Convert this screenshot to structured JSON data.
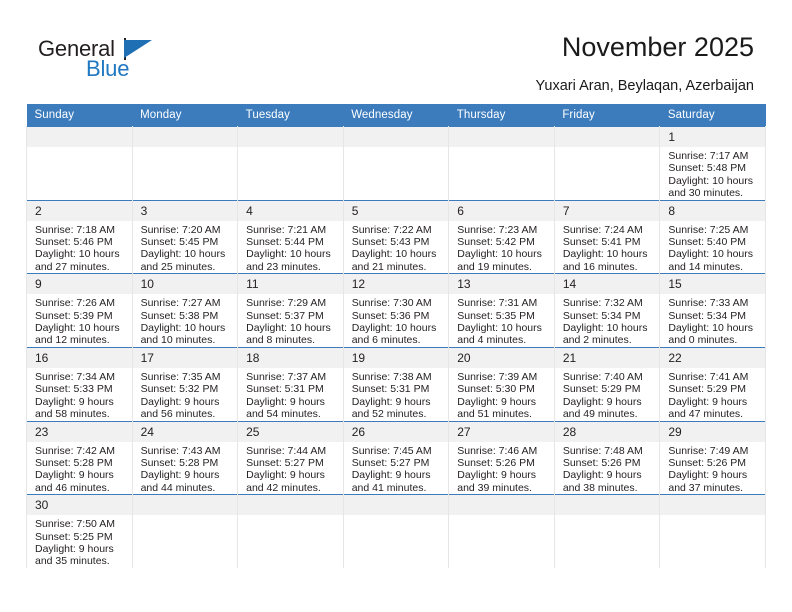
{
  "brand": {
    "name_part1": "General",
    "name_part2": "Blue",
    "accent_color": "#1f6fb5"
  },
  "header": {
    "title": "November 2025",
    "subtitle": "Yuxari Aran, Beylaqan, Azerbaijan",
    "header_bg": "#3c7cbd",
    "daynum_bg": "#f1f1f1"
  },
  "weekday_headers": [
    "Sunday",
    "Monday",
    "Tuesday",
    "Wednesday",
    "Thursday",
    "Friday",
    "Saturday"
  ],
  "weeks": [
    [
      {
        "day": "",
        "sunrise": "",
        "sunset": "",
        "daylight1": "",
        "daylight2": "",
        "empty": true
      },
      {
        "day": "",
        "sunrise": "",
        "sunset": "",
        "daylight1": "",
        "daylight2": "",
        "empty": true
      },
      {
        "day": "",
        "sunrise": "",
        "sunset": "",
        "daylight1": "",
        "daylight2": "",
        "empty": true
      },
      {
        "day": "",
        "sunrise": "",
        "sunset": "",
        "daylight1": "",
        "daylight2": "",
        "empty": true
      },
      {
        "day": "",
        "sunrise": "",
        "sunset": "",
        "daylight1": "",
        "daylight2": "",
        "empty": true
      },
      {
        "day": "",
        "sunrise": "",
        "sunset": "",
        "daylight1": "",
        "daylight2": "",
        "empty": true
      },
      {
        "day": "1",
        "sunrise": "Sunrise: 7:17 AM",
        "sunset": "Sunset: 5:48 PM",
        "daylight1": "Daylight: 10 hours",
        "daylight2": "and 30 minutes.",
        "empty": false
      }
    ],
    [
      {
        "day": "2",
        "sunrise": "Sunrise: 7:18 AM",
        "sunset": "Sunset: 5:46 PM",
        "daylight1": "Daylight: 10 hours",
        "daylight2": "and 27 minutes.",
        "empty": false
      },
      {
        "day": "3",
        "sunrise": "Sunrise: 7:20 AM",
        "sunset": "Sunset: 5:45 PM",
        "daylight1": "Daylight: 10 hours",
        "daylight2": "and 25 minutes.",
        "empty": false
      },
      {
        "day": "4",
        "sunrise": "Sunrise: 7:21 AM",
        "sunset": "Sunset: 5:44 PM",
        "daylight1": "Daylight: 10 hours",
        "daylight2": "and 23 minutes.",
        "empty": false
      },
      {
        "day": "5",
        "sunrise": "Sunrise: 7:22 AM",
        "sunset": "Sunset: 5:43 PM",
        "daylight1": "Daylight: 10 hours",
        "daylight2": "and 21 minutes.",
        "empty": false
      },
      {
        "day": "6",
        "sunrise": "Sunrise: 7:23 AM",
        "sunset": "Sunset: 5:42 PM",
        "daylight1": "Daylight: 10 hours",
        "daylight2": "and 19 minutes.",
        "empty": false
      },
      {
        "day": "7",
        "sunrise": "Sunrise: 7:24 AM",
        "sunset": "Sunset: 5:41 PM",
        "daylight1": "Daylight: 10 hours",
        "daylight2": "and 16 minutes.",
        "empty": false
      },
      {
        "day": "8",
        "sunrise": "Sunrise: 7:25 AM",
        "sunset": "Sunset: 5:40 PM",
        "daylight1": "Daylight: 10 hours",
        "daylight2": "and 14 minutes.",
        "empty": false
      }
    ],
    [
      {
        "day": "9",
        "sunrise": "Sunrise: 7:26 AM",
        "sunset": "Sunset: 5:39 PM",
        "daylight1": "Daylight: 10 hours",
        "daylight2": "and 12 minutes.",
        "empty": false
      },
      {
        "day": "10",
        "sunrise": "Sunrise: 7:27 AM",
        "sunset": "Sunset: 5:38 PM",
        "daylight1": "Daylight: 10 hours",
        "daylight2": "and 10 minutes.",
        "empty": false
      },
      {
        "day": "11",
        "sunrise": "Sunrise: 7:29 AM",
        "sunset": "Sunset: 5:37 PM",
        "daylight1": "Daylight: 10 hours",
        "daylight2": "and 8 minutes.",
        "empty": false
      },
      {
        "day": "12",
        "sunrise": "Sunrise: 7:30 AM",
        "sunset": "Sunset: 5:36 PM",
        "daylight1": "Daylight: 10 hours",
        "daylight2": "and 6 minutes.",
        "empty": false
      },
      {
        "day": "13",
        "sunrise": "Sunrise: 7:31 AM",
        "sunset": "Sunset: 5:35 PM",
        "daylight1": "Daylight: 10 hours",
        "daylight2": "and 4 minutes.",
        "empty": false
      },
      {
        "day": "14",
        "sunrise": "Sunrise: 7:32 AM",
        "sunset": "Sunset: 5:34 PM",
        "daylight1": "Daylight: 10 hours",
        "daylight2": "and 2 minutes.",
        "empty": false
      },
      {
        "day": "15",
        "sunrise": "Sunrise: 7:33 AM",
        "sunset": "Sunset: 5:34 PM",
        "daylight1": "Daylight: 10 hours",
        "daylight2": "and 0 minutes.",
        "empty": false
      }
    ],
    [
      {
        "day": "16",
        "sunrise": "Sunrise: 7:34 AM",
        "sunset": "Sunset: 5:33 PM",
        "daylight1": "Daylight: 9 hours",
        "daylight2": "and 58 minutes.",
        "empty": false
      },
      {
        "day": "17",
        "sunrise": "Sunrise: 7:35 AM",
        "sunset": "Sunset: 5:32 PM",
        "daylight1": "Daylight: 9 hours",
        "daylight2": "and 56 minutes.",
        "empty": false
      },
      {
        "day": "18",
        "sunrise": "Sunrise: 7:37 AM",
        "sunset": "Sunset: 5:31 PM",
        "daylight1": "Daylight: 9 hours",
        "daylight2": "and 54 minutes.",
        "empty": false
      },
      {
        "day": "19",
        "sunrise": "Sunrise: 7:38 AM",
        "sunset": "Sunset: 5:31 PM",
        "daylight1": "Daylight: 9 hours",
        "daylight2": "and 52 minutes.",
        "empty": false
      },
      {
        "day": "20",
        "sunrise": "Sunrise: 7:39 AM",
        "sunset": "Sunset: 5:30 PM",
        "daylight1": "Daylight: 9 hours",
        "daylight2": "and 51 minutes.",
        "empty": false
      },
      {
        "day": "21",
        "sunrise": "Sunrise: 7:40 AM",
        "sunset": "Sunset: 5:29 PM",
        "daylight1": "Daylight: 9 hours",
        "daylight2": "and 49 minutes.",
        "empty": false
      },
      {
        "day": "22",
        "sunrise": "Sunrise: 7:41 AM",
        "sunset": "Sunset: 5:29 PM",
        "daylight1": "Daylight: 9 hours",
        "daylight2": "and 47 minutes.",
        "empty": false
      }
    ],
    [
      {
        "day": "23",
        "sunrise": "Sunrise: 7:42 AM",
        "sunset": "Sunset: 5:28 PM",
        "daylight1": "Daylight: 9 hours",
        "daylight2": "and 46 minutes.",
        "empty": false
      },
      {
        "day": "24",
        "sunrise": "Sunrise: 7:43 AM",
        "sunset": "Sunset: 5:28 PM",
        "daylight1": "Daylight: 9 hours",
        "daylight2": "and 44 minutes.",
        "empty": false
      },
      {
        "day": "25",
        "sunrise": "Sunrise: 7:44 AM",
        "sunset": "Sunset: 5:27 PM",
        "daylight1": "Daylight: 9 hours",
        "daylight2": "and 42 minutes.",
        "empty": false
      },
      {
        "day": "26",
        "sunrise": "Sunrise: 7:45 AM",
        "sunset": "Sunset: 5:27 PM",
        "daylight1": "Daylight: 9 hours",
        "daylight2": "and 41 minutes.",
        "empty": false
      },
      {
        "day": "27",
        "sunrise": "Sunrise: 7:46 AM",
        "sunset": "Sunset: 5:26 PM",
        "daylight1": "Daylight: 9 hours",
        "daylight2": "and 39 minutes.",
        "empty": false
      },
      {
        "day": "28",
        "sunrise": "Sunrise: 7:48 AM",
        "sunset": "Sunset: 5:26 PM",
        "daylight1": "Daylight: 9 hours",
        "daylight2": "and 38 minutes.",
        "empty": false
      },
      {
        "day": "29",
        "sunrise": "Sunrise: 7:49 AM",
        "sunset": "Sunset: 5:26 PM",
        "daylight1": "Daylight: 9 hours",
        "daylight2": "and 37 minutes.",
        "empty": false
      }
    ],
    [
      {
        "day": "30",
        "sunrise": "Sunrise: 7:50 AM",
        "sunset": "Sunset: 5:25 PM",
        "daylight1": "Daylight: 9 hours",
        "daylight2": "and 35 minutes.",
        "empty": false
      },
      {
        "day": "",
        "sunrise": "",
        "sunset": "",
        "daylight1": "",
        "daylight2": "",
        "empty": true
      },
      {
        "day": "",
        "sunrise": "",
        "sunset": "",
        "daylight1": "",
        "daylight2": "",
        "empty": true
      },
      {
        "day": "",
        "sunrise": "",
        "sunset": "",
        "daylight1": "",
        "daylight2": "",
        "empty": true
      },
      {
        "day": "",
        "sunrise": "",
        "sunset": "",
        "daylight1": "",
        "daylight2": "",
        "empty": true
      },
      {
        "day": "",
        "sunrise": "",
        "sunset": "",
        "daylight1": "",
        "daylight2": "",
        "empty": true
      },
      {
        "day": "",
        "sunrise": "",
        "sunset": "",
        "daylight1": "",
        "daylight2": "",
        "empty": true
      }
    ]
  ]
}
